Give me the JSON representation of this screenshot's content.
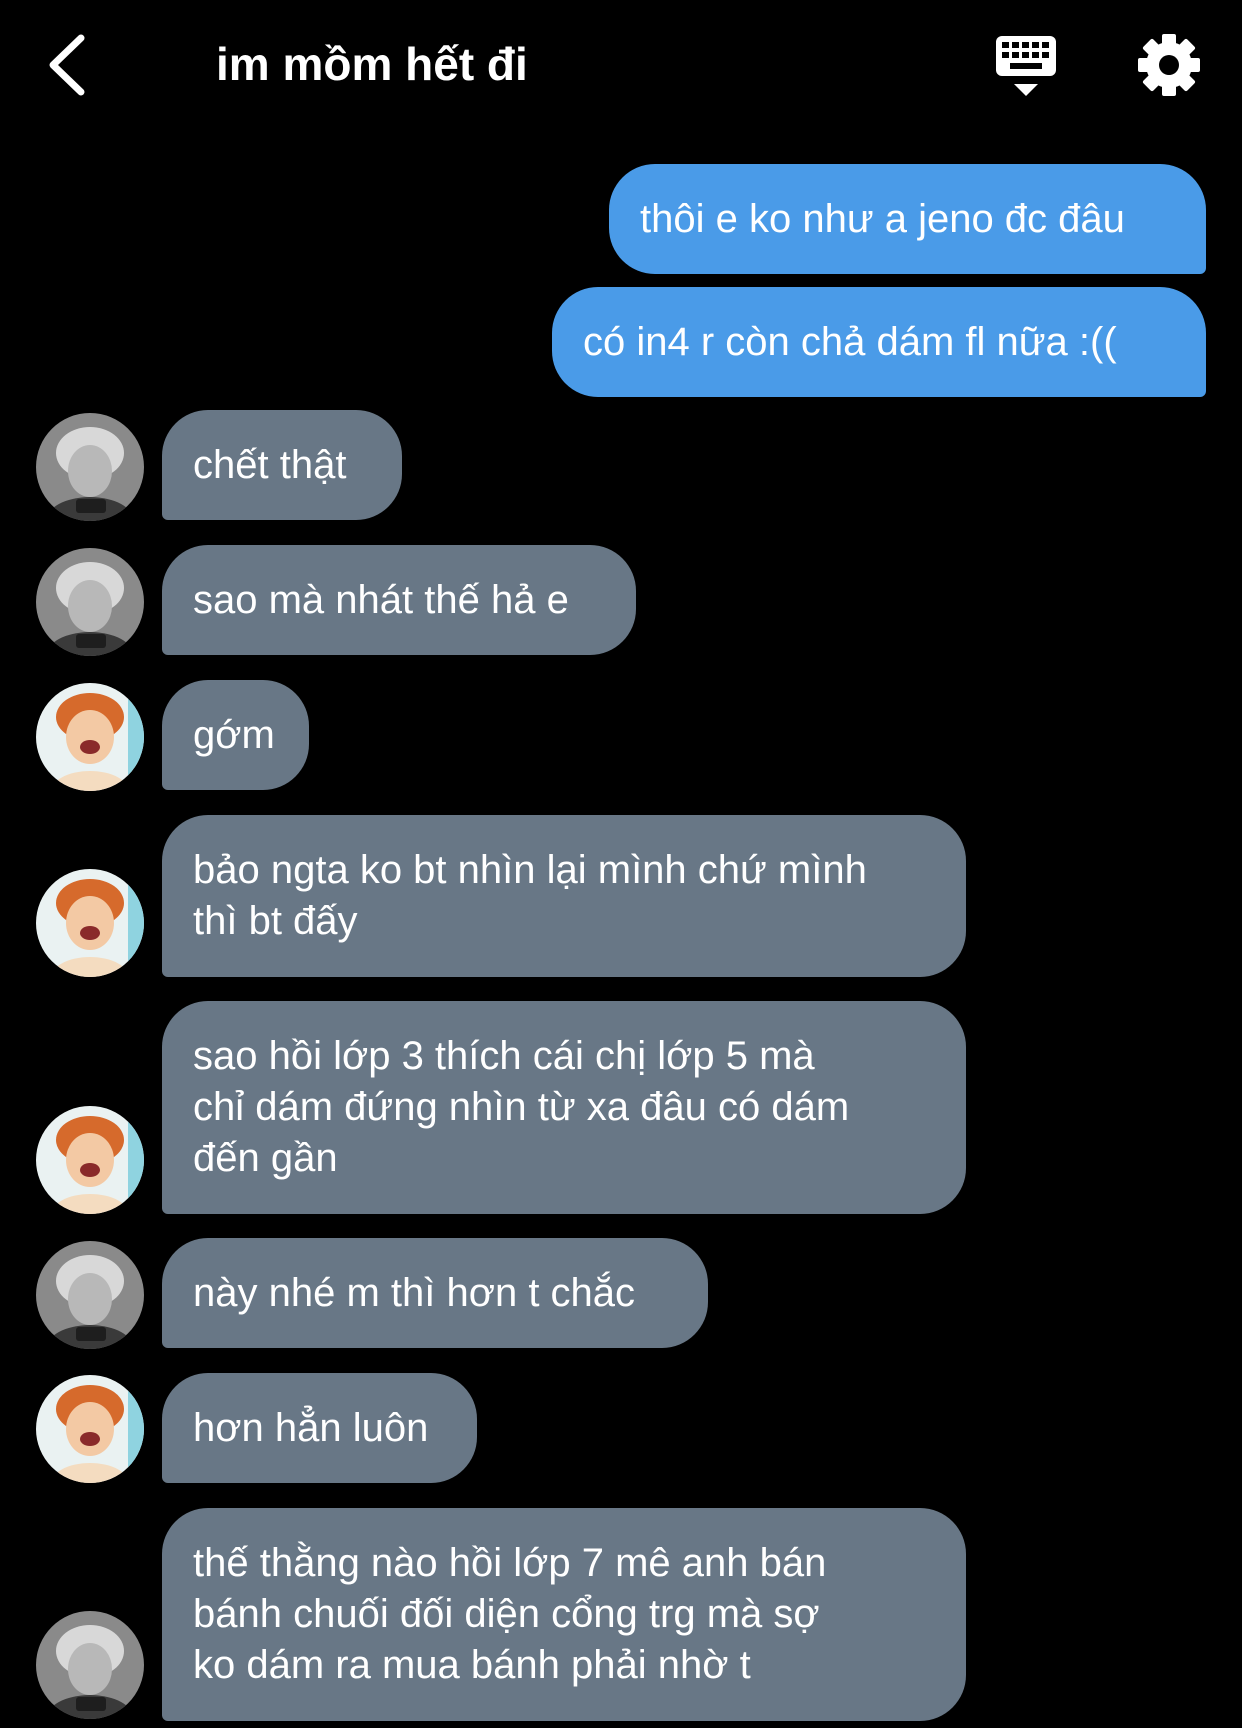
{
  "header": {
    "title": "im mồm hết đi",
    "back_icon": "chevron-left-icon",
    "keyboard_icon": "keyboard-hide-icon",
    "settings_icon": "gear-icon"
  },
  "colors": {
    "background": "#000000",
    "outgoing_bubble": "#4a9be8",
    "incoming_bubble": "#687786",
    "text": "#ffffff"
  },
  "messages": [
    {
      "direction": "outgoing",
      "lines": [
        "thôi e ko như a jeno đc đâu"
      ]
    },
    {
      "direction": "outgoing",
      "lines": [
        "có in4 r còn chả dám fl nữa :(("
      ]
    },
    {
      "direction": "incoming",
      "avatar": "avatar-gray",
      "lines": [
        "chết thật"
      ]
    },
    {
      "direction": "incoming",
      "avatar": "avatar-gray",
      "lines": [
        "sao mà nhát thế hả e"
      ]
    },
    {
      "direction": "incoming",
      "avatar": "avatar-orange",
      "lines": [
        "gớm"
      ]
    },
    {
      "direction": "incoming",
      "avatar": "avatar-orange",
      "lines": [
        "bảo ngta ko bt nhìn lại mình chứ mình",
        "thì bt đấy"
      ]
    },
    {
      "direction": "incoming",
      "avatar": "avatar-orange",
      "lines": [
        "sao hồi lớp 3 thích cái chị lớp 5 mà",
        "chỉ dám đứng nhìn từ xa đâu có dám",
        "đến gần"
      ]
    },
    {
      "direction": "incoming",
      "avatar": "avatar-gray",
      "lines": [
        "này nhé m thì hơn t chắc"
      ]
    },
    {
      "direction": "incoming",
      "avatar": "avatar-orange",
      "lines": [
        "hơn hẳn luôn"
      ]
    },
    {
      "direction": "incoming",
      "avatar": "avatar-gray",
      "lines": [
        "thế thằng nào hồi lớp 7 mê anh bán",
        "bánh chuối đối diện cổng trg mà sợ",
        "ko dám ra mua bánh phải nhờ t"
      ]
    }
  ]
}
